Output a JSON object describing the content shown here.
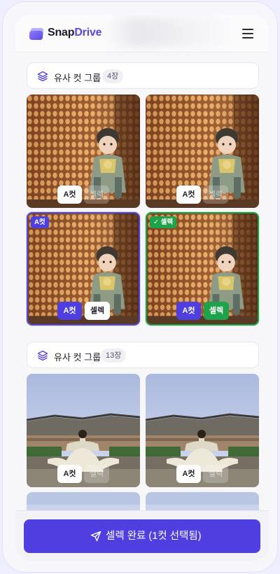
{
  "app": {
    "brand_prefix": "Snap",
    "brand_suffix": "Drive",
    "accent_color": "#5a49e4",
    "a_color": "#4f3fe0",
    "select_color": "#1fa34a"
  },
  "groups": [
    {
      "title": "유사 컷 그룹",
      "count": "4장",
      "photos": [
        {
          "a_label": "A컷",
          "select_label": "셀렉",
          "state": "none"
        },
        {
          "a_label": "A컷",
          "select_label": "셀렉",
          "state": "none"
        },
        {
          "a_label": "A컷",
          "select_label": "셀렉",
          "state": "a",
          "tag": "A컷"
        },
        {
          "a_label": "A컷",
          "select_label": "셀렉",
          "state": "select",
          "tag": "✓ 셀렉"
        }
      ]
    },
    {
      "title": "유사 컷 그룹",
      "count": "13장",
      "photos": [
        {
          "a_label": "A컷",
          "select_label": "셀렉",
          "state": "none"
        },
        {
          "a_label": "A컷",
          "select_label": "셀렉",
          "state": "none"
        }
      ]
    }
  ],
  "footer": {
    "complete_label": "셀렉 완료 (1컷 선택됨)",
    "icon": "send-icon"
  }
}
